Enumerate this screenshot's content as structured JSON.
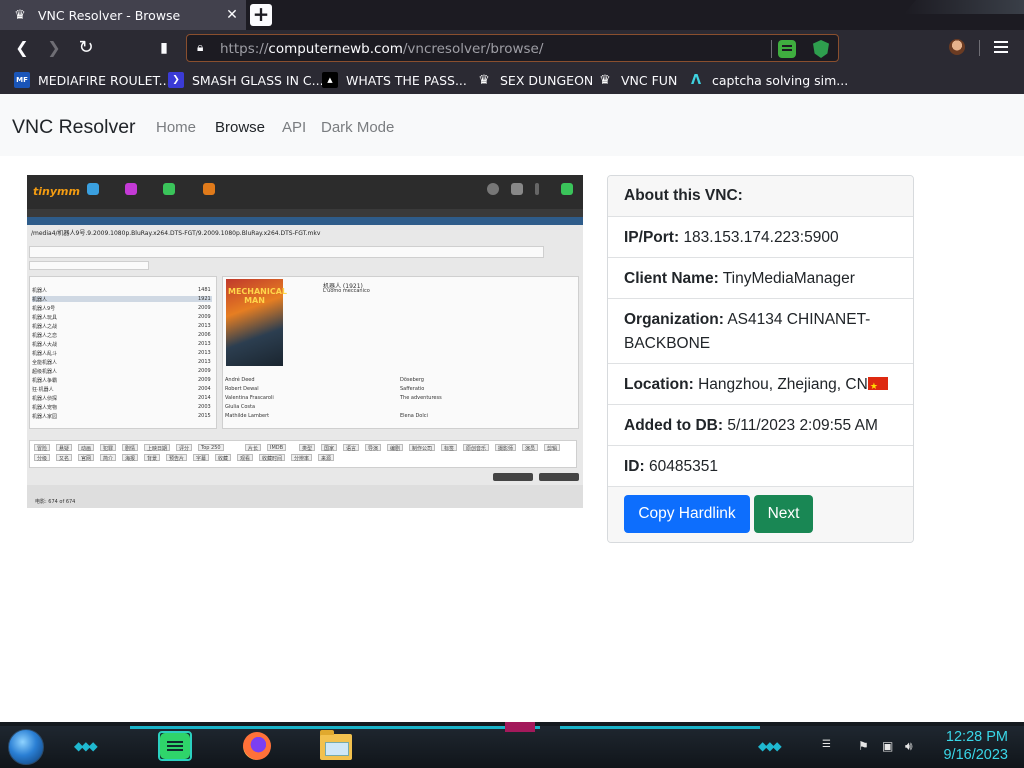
{
  "browser": {
    "tab_title": "VNC Resolver - Browse",
    "tab_close": "✕",
    "new_tab": "+",
    "url_prefix": "https://",
    "url_domain": "computernewb.com",
    "url_path": "/vncresolver/browse/",
    "bookmarks": [
      {
        "label": "MEDIAFIRE ROULET...",
        "icon": "mf-icon",
        "icon_text": "MF"
      },
      {
        "label": "SMASH GLASS IN C...",
        "icon": "chevron-icon",
        "icon_text": "❯"
      },
      {
        "label": "WHATS THE PASS...",
        "icon": "lock-icon",
        "icon_text": "▲"
      },
      {
        "label": "SEX DUNGEON",
        "icon": "mask-icon",
        "icon_text": "♛"
      },
      {
        "label": "VNC FUN",
        "icon": "mask-icon",
        "icon_text": "♛"
      },
      {
        "label": "captcha solving sim...",
        "icon": "a-icon",
        "icon_text": "Λ"
      }
    ]
  },
  "site": {
    "brand": "VNC Resolver",
    "nav": [
      "Home",
      "Browse",
      "API",
      "Dark Mode"
    ],
    "active_nav": "Browse"
  },
  "thumbnail": {
    "app_logo": "tinymm",
    "file_path": "/media4/机器人9号.9.2009.1080p.BluRay.x264.DTS-FGT/9.2009.1080p.BluRay.x264.DTS-FGT.mkv",
    "poster_title": "MECHANICAL MAN",
    "list_rows": [
      "机器人",
      "机器人",
      "机器人9号",
      "机器人玩具",
      "机器人之战",
      "机器人之恋",
      "机器人大战",
      "机器人乱斗",
      "全能机器人",
      "超级机器人",
      "机器人争霸",
      "狂·机器人",
      "机器人侦探",
      "机器人宠物",
      "机器人家园"
    ],
    "list_years": [
      "1481",
      "1921",
      "2009",
      "2009",
      "2013",
      "2006",
      "2013",
      "2013",
      "2013",
      "2009",
      "2009",
      "2004",
      "2014",
      "2003",
      "2015"
    ],
    "movie_title": "机器人 (1921)",
    "movie_original": "L'uomo meccanico",
    "cast": [
      "André Deed",
      "Robert Dewal",
      "Valentina Frascaroli",
      "Giulia Costa",
      "Mathilde Lambert"
    ],
    "roles": [
      "Döseberg",
      "Safferatio",
      "The adventuress",
      "",
      "Elena Dolci"
    ],
    "tags": [
      "冒险",
      "悬疑",
      "动画",
      "犯罪",
      "剧情",
      "上映日期",
      "评分",
      "Top 250",
      "片长",
      "IMDB",
      "类型",
      "国家",
      "语言",
      "导演",
      "编剧",
      "制作公司",
      "标签",
      "原创音乐",
      "摄影师",
      "演员",
      "剪辑",
      "分级",
      "又名",
      "官网",
      "简介",
      "海报",
      "背景",
      "预告片",
      "字幕",
      "收藏",
      "观看",
      "收藏时间",
      "分辨率",
      "来源"
    ],
    "status": "电影: 674 of 674"
  },
  "about": {
    "header": "About this VNC:",
    "ip_label": "IP/Port:",
    "ip_value": "183.153.174.223:5900",
    "client_label": "Client Name:",
    "client_value": "TinyMediaManager",
    "org_label": "Organization:",
    "org_value": "AS4134 CHINANET-BACKBONE",
    "location_label": "Location:",
    "location_value": "Hangzhou, Zhejiang, CN",
    "added_label": "Added to DB:",
    "added_value": "5/11/2023 2:09:55 AM",
    "id_label": "ID:",
    "id_value": "60485351",
    "copy_button": "Copy Hardlink",
    "next_button": "Next",
    "colors": {
      "primary": "#0d6efd",
      "success": "#198754"
    }
  },
  "taskbar": {
    "time": "12:28 PM",
    "date": "9/16/2023"
  }
}
